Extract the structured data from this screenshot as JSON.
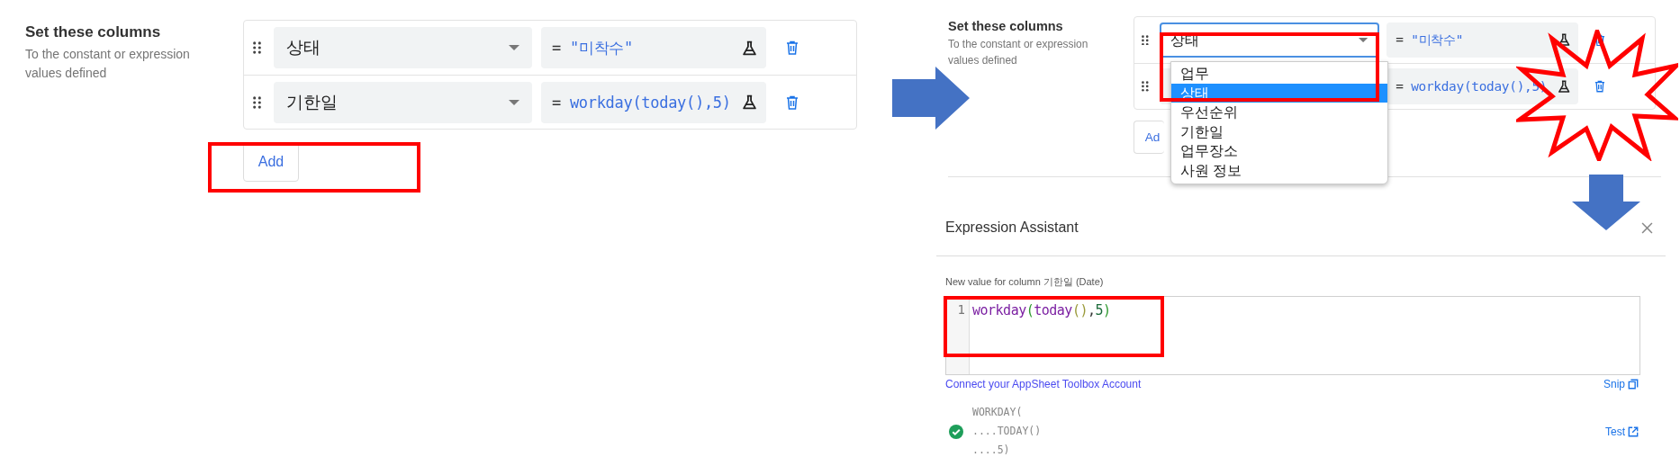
{
  "left_panel": {
    "section_title": "Set these columns",
    "section_hint": "To the constant or expression values defined",
    "rows": [
      {
        "column": "상태",
        "operator": "=",
        "expression": "\"미착수\"",
        "open": false
      },
      {
        "column": "기한일",
        "operator": "=",
        "expression": "workday(today(),5)",
        "open": false
      }
    ],
    "add_button": "Add"
  },
  "right_panel": {
    "section_title": "Set these columns",
    "section_hint": "To the constant or expression values defined",
    "rows": [
      {
        "column": "상태",
        "operator": "=",
        "expression": "\"미착수\"",
        "open": true
      },
      {
        "operator": "=",
        "expression": "workday(today(),5)",
        "open": false
      }
    ],
    "add_button": "Ad",
    "dropdown": [
      {
        "label": "업무",
        "selected": false
      },
      {
        "label": "상태",
        "selected": true
      },
      {
        "label": "우선순위",
        "selected": false
      },
      {
        "label": "기한일",
        "selected": false
      },
      {
        "label": "업무장소",
        "selected": false
      },
      {
        "label": "사원 정보",
        "selected": false
      }
    ]
  },
  "expression_assistant": {
    "title": "Expression Assistant",
    "field_label": "New value for column 기한일 (Date)",
    "line_number": "1",
    "code_tokens": [
      {
        "text": "workday",
        "kind": "function"
      },
      {
        "text": "(",
        "kind": "bracket"
      },
      {
        "text": "today",
        "kind": "function"
      },
      {
        "text": "()",
        "kind": "inner-bracket"
      },
      {
        "text": ",",
        "kind": "punct"
      },
      {
        "text": "5",
        "kind": "number"
      },
      {
        "text": ")",
        "kind": "bracket"
      }
    ],
    "toolbox_link": "Connect your AppSheet Toolbox Account",
    "snip_link": "Snip",
    "valid": true,
    "result_lines": [
      "WORKDAY(",
      "....TODAY()",
      "....5)"
    ],
    "test_link": "Test"
  }
}
